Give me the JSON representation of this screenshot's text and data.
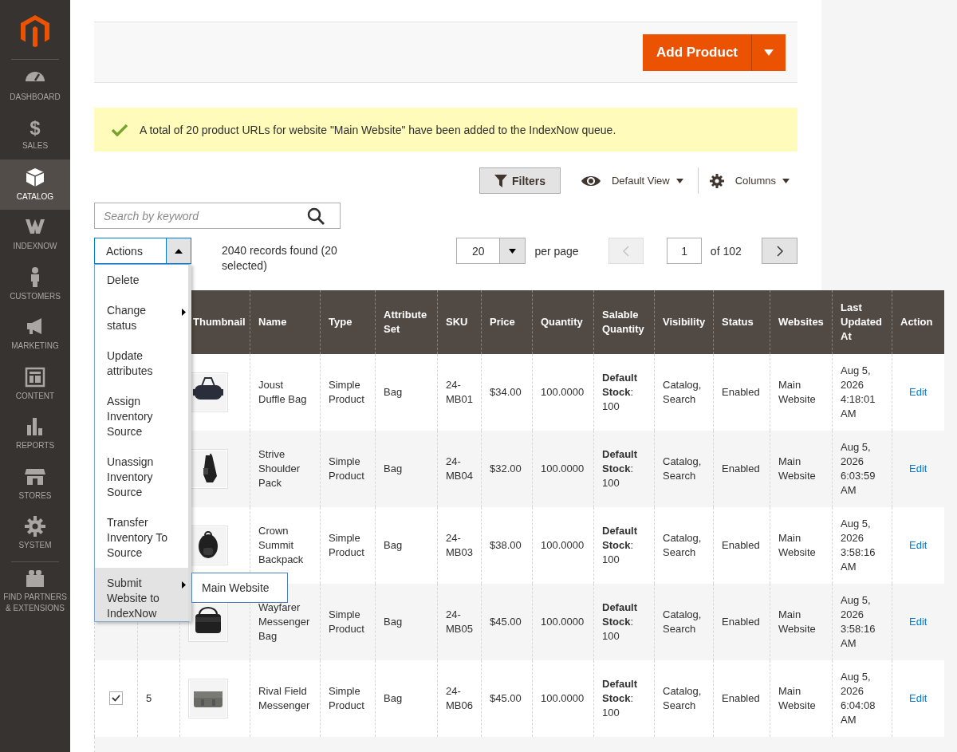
{
  "sidebar": {
    "items": [
      {
        "label": "DASHBOARD",
        "selected": false
      },
      {
        "label": "SALES",
        "selected": false,
        "glyph": "$"
      },
      {
        "label": "CATALOG",
        "selected": true
      },
      {
        "label": "INDEXNOW",
        "selected": false
      },
      {
        "label": "CUSTOMERS",
        "selected": false
      },
      {
        "label": "MARKETING",
        "selected": false
      },
      {
        "label": "CONTENT",
        "selected": false
      },
      {
        "label": "REPORTS",
        "selected": false
      },
      {
        "label": "STORES",
        "selected": false
      },
      {
        "label": "SYSTEM",
        "selected": false
      },
      {
        "label": "FIND PARTNERS & EXTENSIONS",
        "selected": false
      }
    ]
  },
  "header": {
    "add_button": "Add Product"
  },
  "message": "A total of 20 product URLs for website \"Main Website\" have been added to the IndexNow queue.",
  "toolbar": {
    "filters": "Filters",
    "view": "Default View",
    "columns": "Columns"
  },
  "search": {
    "placeholder": "Search by keyword"
  },
  "actions": {
    "label": "Actions",
    "expanded": true,
    "items": [
      {
        "label": "Delete",
        "submenu": false,
        "selected": false
      },
      {
        "label": "Change status",
        "submenu": true,
        "selected": false
      },
      {
        "label": "Update attributes",
        "submenu": false,
        "selected": false
      },
      {
        "label": "Assign Inventory Source",
        "submenu": false,
        "selected": false
      },
      {
        "label": "Unassign Inventory Source",
        "submenu": false,
        "selected": false
      },
      {
        "label": "Transfer Inventory To Source",
        "submenu": false,
        "selected": false
      },
      {
        "label": "Submit Website to IndexNow",
        "submenu": true,
        "selected": true
      }
    ],
    "submenu_items": [
      "Main Website"
    ]
  },
  "records": "2040 records found (20 selected)",
  "per_page": {
    "value": "20",
    "label": "per page"
  },
  "pagination": {
    "prev_disabled": true,
    "page": "1",
    "of": "of 102"
  },
  "table": {
    "columns": [
      "Thumbnail",
      "Name",
      "Type",
      "Attribute Set",
      "SKU",
      "Price",
      "Quantity",
      "Salable Quantity",
      "Visibility",
      "Status",
      "Websites",
      "Last Updated At",
      "Action"
    ],
    "rows": [
      {
        "name": "Joust Duffle Bag",
        "type": "Simple Product",
        "attribute_set": "Bag",
        "sku": "24-MB01",
        "price": "$34.00",
        "quantity": "100.0000",
        "salable": "**Default Stock**: 100",
        "visibility": "Catalog, Search",
        "status": "Enabled",
        "websites": "Main Website",
        "updated": "Aug 5, 2026 4:18:01 AM",
        "action": "Edit"
      },
      {
        "name": "Strive Shoulder Pack",
        "type": "Simple Product",
        "attribute_set": "Bag",
        "sku": "24-MB04",
        "price": "$32.00",
        "quantity": "100.0000",
        "salable": "**Default Stock**: 100",
        "visibility": "Catalog, Search",
        "status": "Enabled",
        "websites": "Main Website",
        "updated": "Aug 5, 2026 6:03:59 AM",
        "action": "Edit"
      },
      {
        "name": "Crown Summit Backpack",
        "type": "Simple Product",
        "attribute_set": "Bag",
        "sku": "24-MB03",
        "price": "$38.00",
        "quantity": "100.0000",
        "salable": "**Default Stock**: 100",
        "visibility": "Catalog, Search",
        "status": "Enabled",
        "websites": "Main Website",
        "updated": "Aug 5, 2026 3:58:16 AM",
        "action": "Edit"
      },
      {
        "name": "Wayfarer Messenger Bag",
        "type": "Simple Product",
        "attribute_set": "Bag",
        "sku": "24-MB05",
        "price": "$45.00",
        "quantity": "100.0000",
        "salable": "**Default Stock**: 100",
        "visibility": "Catalog, Search",
        "status": "Enabled",
        "websites": "Main Website",
        "updated": "Aug 5, 2026 3:58:16 AM",
        "action": "Edit"
      },
      {
        "checked": true,
        "id": "5",
        "name": "Rival Field Messenger",
        "type": "Simple Product",
        "attribute_set": "Bag",
        "sku": "24-MB06",
        "price": "$45.00",
        "quantity": "100.0000",
        "salable": "**Default Stock**: 100",
        "visibility": "Catalog, Search",
        "status": "Enabled",
        "websites": "Main Website",
        "updated": "Aug 5, 2026 6:04:08 AM",
        "action": "Edit"
      }
    ]
  }
}
